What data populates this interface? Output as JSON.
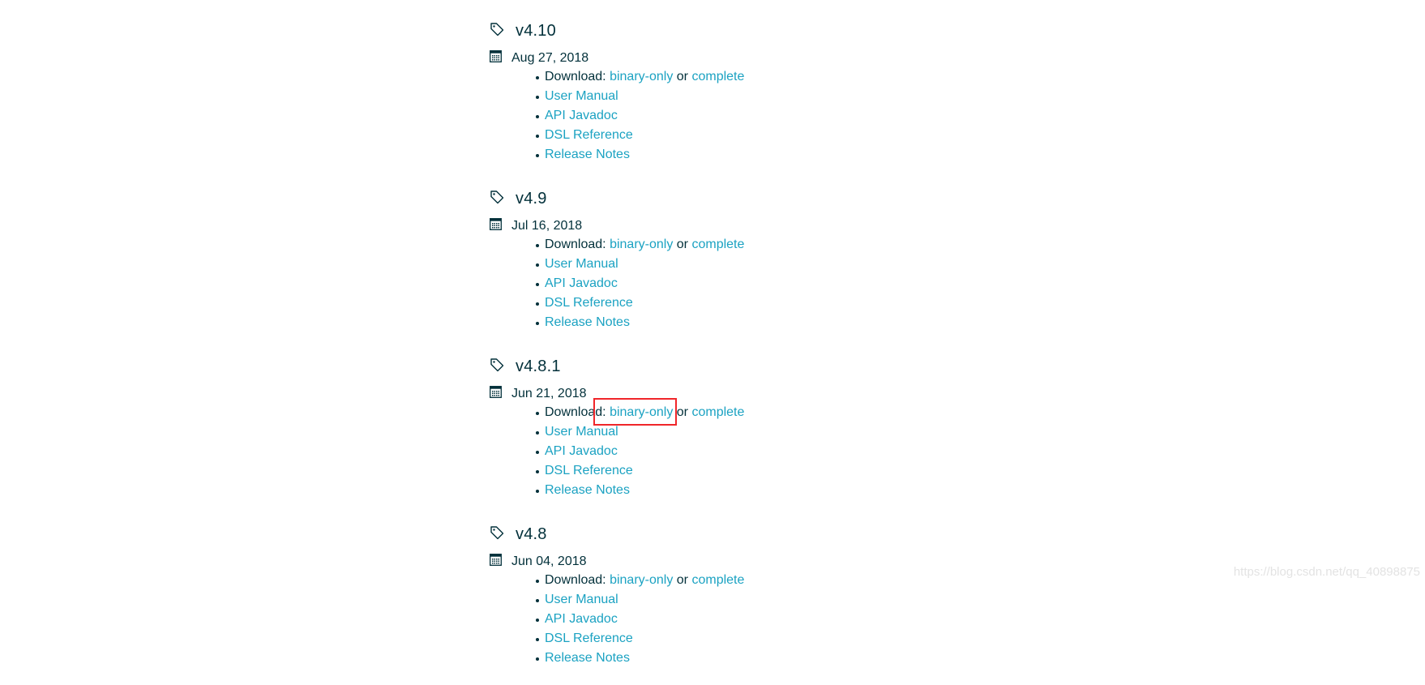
{
  "releases": [
    {
      "version": "v4.10",
      "date": "Aug 27, 2018"
    },
    {
      "version": "v4.9",
      "date": "Jul 16, 2018"
    },
    {
      "version": "v4.8.1",
      "date": "Jun 21, 2018"
    },
    {
      "version": "v4.8",
      "date": "Jun 04, 2018"
    }
  ],
  "labels": {
    "download": "Download:",
    "binary_only": "binary-only",
    "or": "or",
    "complete": "complete",
    "user_manual": "User Manual",
    "api_javadoc": "API Javadoc",
    "dsl_reference": "DSL Reference",
    "release_notes": "Release Notes"
  },
  "icons": {
    "version": "tag-icon",
    "date": "calendar-icon"
  },
  "colors": {
    "link": "#1ba2c2",
    "text": "#02303a",
    "highlight": "#f0262a"
  },
  "watermark": "https://blog.csdn.net/qq_40898875"
}
